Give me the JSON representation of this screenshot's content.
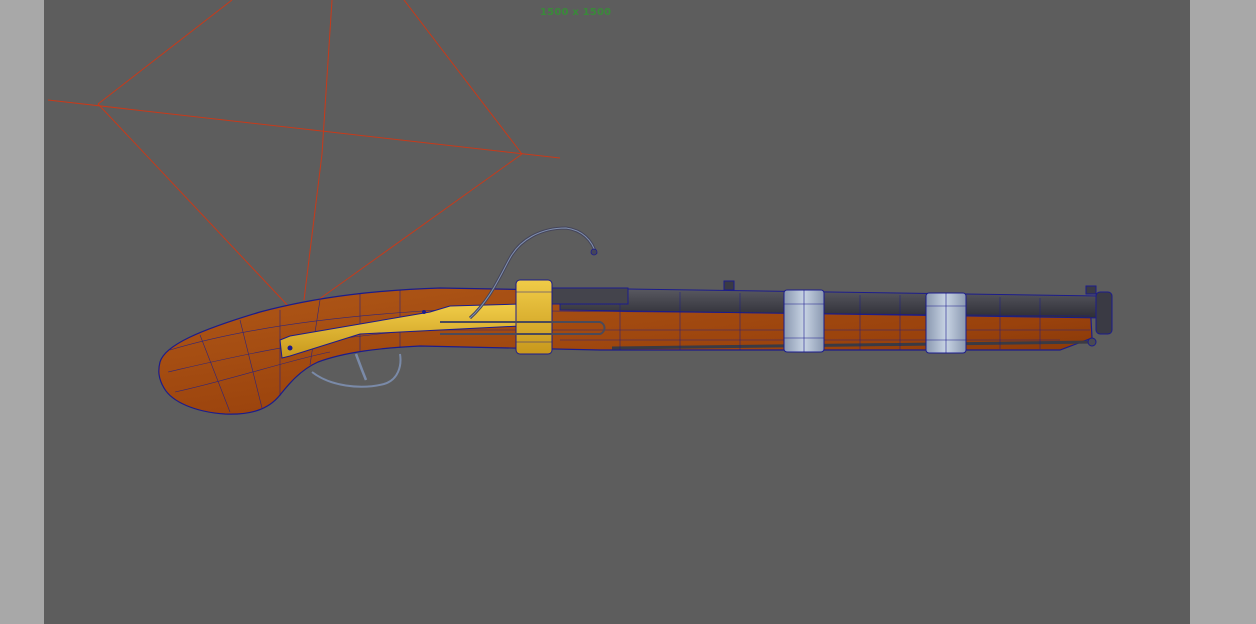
{
  "viewport": {
    "resolution_gate_label": "1500 x 1500",
    "colors": {
      "outside_gate": "#a8a8a8",
      "inside_gate": "#5d5d5d",
      "gate_label": "#3a8a3a",
      "camera_frustum": "#c83a1a",
      "wireframe": "#1c1c8c",
      "wood": "#a84a10",
      "brass": "#e0b830",
      "steel_band": "#aab8cc",
      "barrel_metal": "#4a4a52"
    }
  },
  "scene": {
    "camera_icon": "camera-frustum-icon",
    "model_icon": "matchlock-gun-model"
  }
}
